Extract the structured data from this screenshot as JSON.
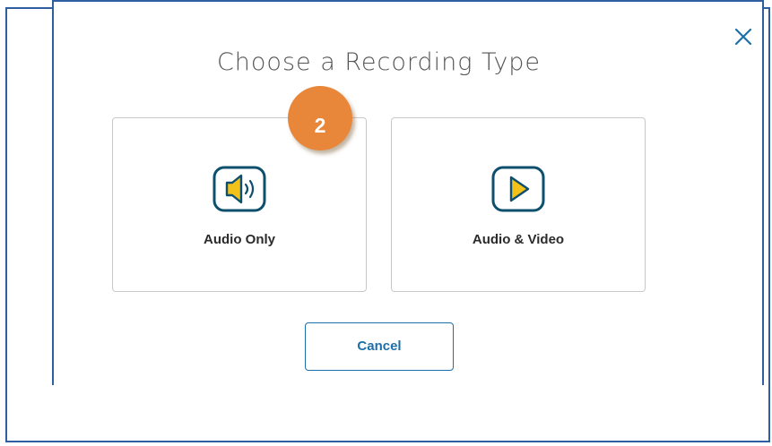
{
  "dialog": {
    "title": "Choose a Recording Type",
    "close_icon": "close-icon",
    "step_badge": "2",
    "options": [
      {
        "label": "Audio Only",
        "icon": "speaker-icon"
      },
      {
        "label": "Audio & Video",
        "icon": "play-icon"
      }
    ],
    "cancel_label": "Cancel"
  },
  "colors": {
    "frame_blue": "#2f5fa0",
    "icon_border": "#0e4f6e",
    "icon_fill": "#f2c21a",
    "badge_orange": "#e8873a",
    "cancel_blue": "#1d6fa8"
  }
}
